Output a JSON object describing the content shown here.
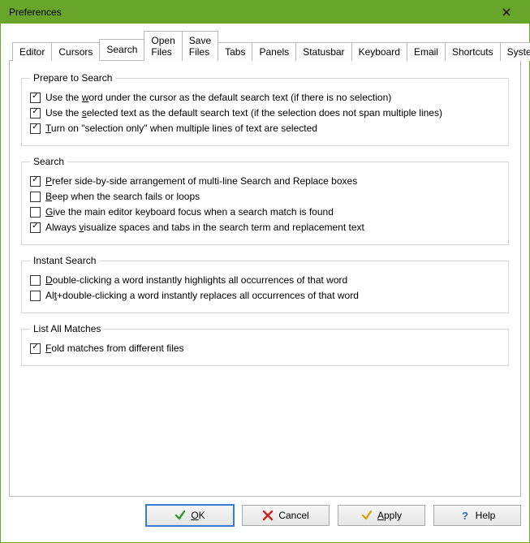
{
  "window": {
    "title": "Preferences"
  },
  "tabs": [
    {
      "label": "Editor"
    },
    {
      "label": "Cursors"
    },
    {
      "label": "Search"
    },
    {
      "label": "Open Files"
    },
    {
      "label": "Save Files"
    },
    {
      "label": "Tabs"
    },
    {
      "label": "Panels"
    },
    {
      "label": "Statusbar"
    },
    {
      "label": "Keyboard"
    },
    {
      "label": "Email"
    },
    {
      "label": "Shortcuts"
    },
    {
      "label": "System"
    }
  ],
  "activeTabIndex": 2,
  "groups": {
    "prepare": {
      "legend": "Prepare to Search",
      "items": [
        {
          "checked": true,
          "pre": "Use the ",
          "u": "w",
          "post": "ord under the cursor as the default search text (if there is no selection)"
        },
        {
          "checked": true,
          "pre": "Use the ",
          "u": "s",
          "post": "elected text as the default search text (if the selection does not span multiple lines)"
        },
        {
          "checked": true,
          "pre": "",
          "u": "T",
          "post": "urn on \"selection only\" when multiple lines of text are selected"
        }
      ]
    },
    "search": {
      "legend": "Search",
      "items": [
        {
          "checked": true,
          "pre": "",
          "u": "P",
          "post": "refer side-by-side arrangement of multi-line Search and Replace boxes"
        },
        {
          "checked": false,
          "pre": "",
          "u": "B",
          "post": "eep when the search fails or loops"
        },
        {
          "checked": false,
          "pre": "",
          "u": "G",
          "post": "ive the main editor keyboard focus when a search match is found"
        },
        {
          "checked": true,
          "pre": "Always ",
          "u": "v",
          "post": "isualize spaces and tabs in the search term and replacement text"
        }
      ]
    },
    "instant": {
      "legend": "Instant Search",
      "items": [
        {
          "checked": false,
          "pre": "",
          "u": "D",
          "post": "ouble-clicking a word instantly highlights all occurrences of that word"
        },
        {
          "checked": false,
          "pre": "Al",
          "u": "t",
          "post": "+double-clicking a word instantly replaces all occurrences of that word"
        }
      ]
    },
    "listall": {
      "legend": "List All Matches",
      "items": [
        {
          "checked": true,
          "pre": "",
          "u": "F",
          "post": "old matches from different files"
        }
      ]
    }
  },
  "buttons": {
    "ok": {
      "u": "O",
      "rest": "K"
    },
    "cancel": {
      "text": "Cancel"
    },
    "apply": {
      "u": "A",
      "rest": "pply"
    },
    "help": {
      "text": "Help"
    }
  }
}
